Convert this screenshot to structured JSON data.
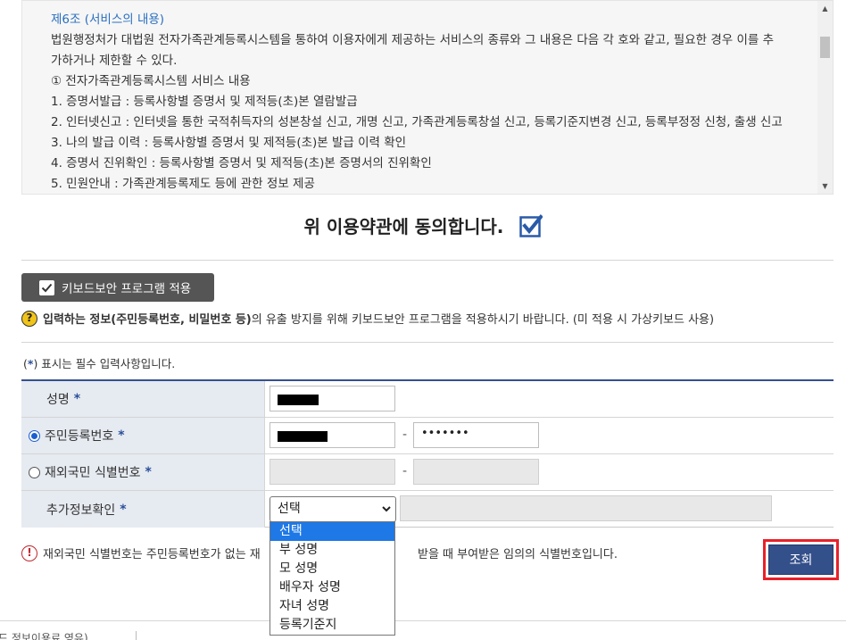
{
  "terms": {
    "article_title": "제6조 (서비스의 내용)",
    "lines": [
      "법원행정처가 대법원 전자가족관계등록시스템을 통하여 이용자에게 제공하는 서비스의 종류와 그 내용은 다음 각 호와 같고, 필요한 경우 이를 추",
      "가하거나 제한할 수 있다.",
      "① 전자가족관계등록시스템 서비스 내용",
      "1. 증명서발급 : 등록사항별 증명서 및 제적등(초)본 열람발급",
      "2. 인터넷신고 : 인터넷을 통한 국적취득자의 성본창설 신고, 개명 신고, 가족관계등록창설 신고, 등록기준지변경 신고, 등록부정정 신청, 출생 신고",
      "3. 나의 발급 이력 : 등록사항별 증명서 및 제적등(초)본 발급 이력 확인",
      "4. 증명서 진위확인 : 등록사항별 증명서 및 제적등(초)본 증명서의 진위확인",
      "5. 민원안내 : 가족관계등록제도 등에 관한 정보 제공"
    ]
  },
  "agree": {
    "text": "위 이용약관에 동의합니다.",
    "checked": true
  },
  "keyboard_security": {
    "button_label": "키보드보안 프로그램 적용",
    "notice_bold": "입력하는 정보(주민등록번호, 비밀번호 등)",
    "notice_rest": "의 유출 방지를 위해 키보드보안 프로그램을 적용하시기 바랍니다. (미 적용 시 가상키보드 사용)"
  },
  "required_note": {
    "prefix": "(",
    "star": "*",
    "suffix": ") 표시는 필수 입력사항입니다."
  },
  "form": {
    "name_label": "성명",
    "rrn_label": "주민등록번호",
    "rrn_back_value": "•••••••",
    "foreigner_label": "재외국민 식별번호",
    "extra_label": "추가정보확인",
    "required_mark": "*",
    "dash": "-",
    "select_value": "선택",
    "select_options": [
      "선택",
      "부 성명",
      "모 성명",
      "배우자 성명",
      "자녀 성명",
      "등록기준지"
    ]
  },
  "bottom_notice": {
    "part1": "재외국민 식별번호는 주민등록번호가 없는 재",
    "part2": "받을 때 부여받은 임의의 식별번호입니다."
  },
  "search_button": "조회",
  "footer_text": "드 정보이용료 영유)"
}
